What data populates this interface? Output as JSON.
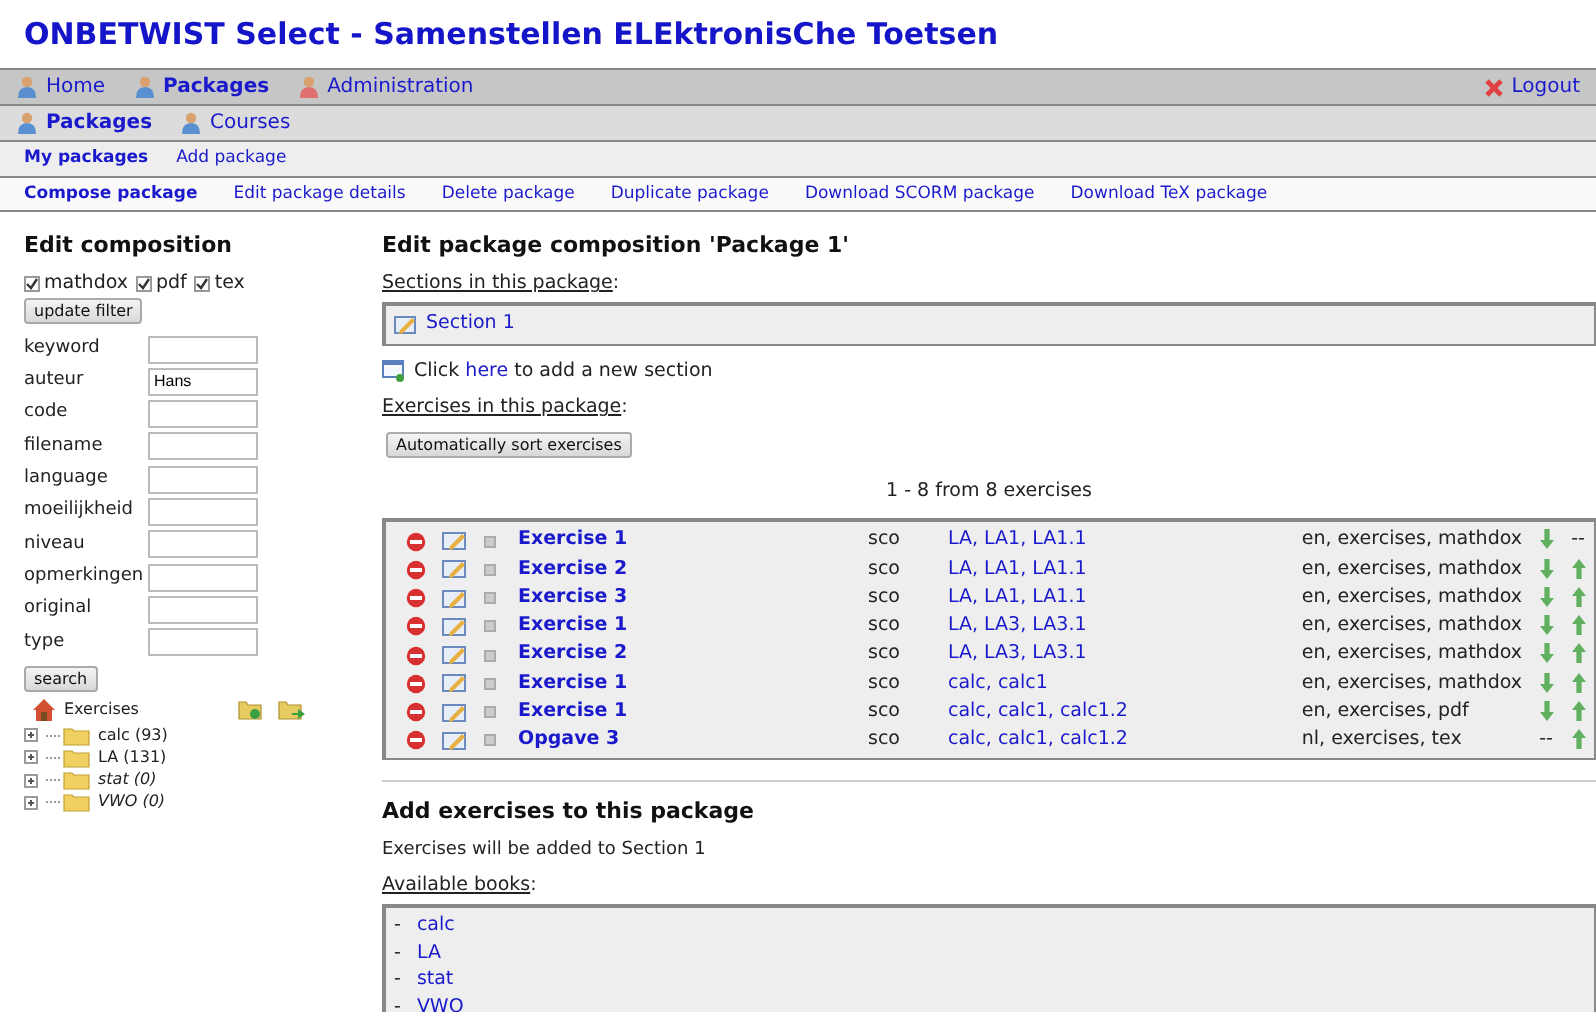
{
  "title": "ONBETWIST Select - Samenstellen ELEktronisChe Toetsen",
  "main_nav": [
    {
      "label": "Home",
      "kind": "user",
      "selected": false
    },
    {
      "label": "Packages",
      "kind": "user",
      "selected": true
    },
    {
      "label": "Administration",
      "kind": "admin",
      "selected": false
    }
  ],
  "logout": "Logout",
  "sub_nav": [
    {
      "label": "Packages",
      "selected": true
    },
    {
      "label": "Courses",
      "selected": false
    }
  ],
  "package_nav": [
    {
      "label": "My packages",
      "selected": true
    },
    {
      "label": "Add package",
      "selected": false
    }
  ],
  "action_nav": [
    {
      "label": "Compose package",
      "selected": true
    },
    {
      "label": "Edit package details",
      "selected": false
    },
    {
      "label": "Delete package",
      "selected": false
    },
    {
      "label": "Duplicate package",
      "selected": false
    },
    {
      "label": "Download SCORM package",
      "selected": false
    },
    {
      "label": "Download TeX package",
      "selected": false
    }
  ],
  "sidebar": {
    "heading": "Edit composition",
    "filters": [
      {
        "label": "mathdox",
        "checked": true
      },
      {
        "label": "pdf",
        "checked": true
      },
      {
        "label": "tex",
        "checked": true
      }
    ],
    "update_button": "update filter",
    "fields": [
      {
        "label": "keyword"
      },
      {
        "label": "auteur",
        "value": "Hans"
      },
      {
        "label": "code"
      },
      {
        "label": "filename"
      },
      {
        "label": "language"
      },
      {
        "label": "moeilijkheid"
      },
      {
        "label": "niveau"
      },
      {
        "label": "opmerkingen"
      },
      {
        "label": "original"
      },
      {
        "label": "type"
      }
    ],
    "search_button": "search",
    "tree": {
      "label": "Exercises",
      "children": [
        {
          "label": "calc (93)",
          "empty": false
        },
        {
          "label": "LA (131)",
          "empty": false
        },
        {
          "label": "stat (0)",
          "empty": true
        },
        {
          "label": "VWO (0)",
          "empty": true
        }
      ]
    }
  },
  "main": {
    "heading": "Edit package composition 'Package 1'",
    "sections_label": {
      "text": "Sections in this package",
      "suffix": ":"
    },
    "sections": [
      "Section 1"
    ],
    "add_section": {
      "before": "Click",
      "link": "here",
      "after": "to add a new section"
    },
    "exercises_label": {
      "text": "Exercises in this package",
      "suffix": ":"
    },
    "sort_button": "Automatically sort exercises",
    "count": "1 - 8 from 8 exercises",
    "exercises": [
      {
        "name": "Exercise 1",
        "type": "sco",
        "path": "LA, LA1, LA1.1",
        "tags": "en, exercises, mathdox",
        "down": {
          "kind": "arrow"
        },
        "up": {
          "kind": "none",
          "text": "--"
        }
      },
      {
        "name": "Exercise 2",
        "type": "sco",
        "path": "LA, LA1, LA1.1",
        "tags": "en, exercises, mathdox",
        "down": {
          "kind": "arrow"
        },
        "up": {
          "kind": "arrow"
        }
      },
      {
        "name": "Exercise 3",
        "type": "sco",
        "path": "LA, LA1, LA1.1",
        "tags": "en, exercises, mathdox",
        "down": {
          "kind": "arrow"
        },
        "up": {
          "kind": "arrow"
        }
      },
      {
        "name": "Exercise 1",
        "type": "sco",
        "path": "LA, LA3, LA3.1",
        "tags": "en, exercises, mathdox",
        "down": {
          "kind": "arrow"
        },
        "up": {
          "kind": "arrow"
        }
      },
      {
        "name": "Exercise 2",
        "type": "sco",
        "path": "LA, LA3, LA3.1",
        "tags": "en, exercises, mathdox",
        "down": {
          "kind": "arrow"
        },
        "up": {
          "kind": "arrow"
        }
      },
      {
        "name": "Exercise 1",
        "type": "sco",
        "path": "calc, calc1",
        "tags": "en, exercises, mathdox",
        "down": {
          "kind": "arrow"
        },
        "up": {
          "kind": "arrow"
        }
      },
      {
        "name": "Exercise 1",
        "type": "sco",
        "path": "calc, calc1, calc1.2",
        "tags": "en, exercises, pdf",
        "down": {
          "kind": "arrow"
        },
        "up": {
          "kind": "arrow"
        }
      },
      {
        "name": "Opgave 3",
        "type": "sco",
        "path": "calc, calc1, calc1.2",
        "tags": "nl, exercises, tex",
        "down": {
          "kind": "none",
          "text": "--"
        },
        "up": {
          "kind": "arrow"
        }
      }
    ],
    "add_heading": "Add exercises to this package",
    "add_note": "Exercises will be added to Section 1",
    "books_label": {
      "text": "Available books",
      "suffix": ":"
    },
    "books": [
      {
        "bullet": "-",
        "name": "calc"
      },
      {
        "bullet": "-",
        "name": "LA"
      },
      {
        "bullet": "-",
        "name": "stat"
      },
      {
        "bullet": "-",
        "name": "VWO"
      }
    ]
  }
}
